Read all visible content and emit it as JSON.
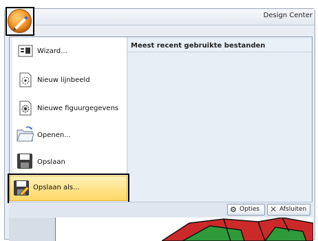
{
  "window": {
    "title": "Design Center"
  },
  "recent": {
    "title": "Meest recent gebruikte bestanden"
  },
  "menu": {
    "items": [
      {
        "label": "Wizard...",
        "icon": "wizard-icon"
      },
      {
        "label": "Nieuw lijnbeeld",
        "icon": "new-line-image-icon"
      },
      {
        "label": "Nieuwe figuurgegevens",
        "icon": "new-figure-data-icon"
      },
      {
        "label": "Openen...",
        "icon": "open-folder-icon"
      },
      {
        "label": "Opslaan",
        "icon": "save-icon"
      },
      {
        "label": "Opslaan als...",
        "icon": "save-as-icon"
      }
    ]
  },
  "buttons": {
    "options": "Opties",
    "exit": "Afsluiten"
  },
  "colors": {
    "highlight": "#ffd764",
    "orb": "#f59a2a",
    "drawing_red": "#cc2a2a",
    "drawing_green": "#2f9a3a"
  }
}
